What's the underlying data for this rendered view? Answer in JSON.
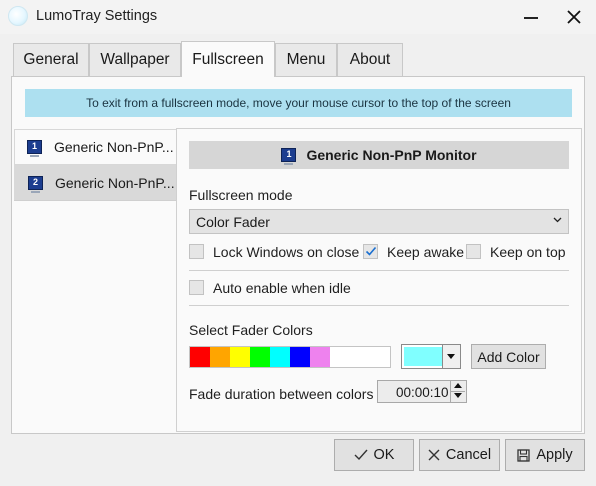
{
  "window": {
    "title": "LumoTray Settings",
    "icons": {
      "app": "app-icon",
      "minimize": "minimize-icon",
      "close": "close-icon"
    }
  },
  "tabs": [
    {
      "label": "General",
      "active": false
    },
    {
      "label": "Wallpaper",
      "active": false
    },
    {
      "label": "Fullscreen",
      "active": true
    },
    {
      "label": "Menu",
      "active": false
    },
    {
      "label": "About",
      "active": false
    }
  ],
  "info_banner": "To exit from a fullscreen mode, move your mouse cursor to the top of the screen",
  "monitors": [
    {
      "number": "1",
      "label": "Generic Non-PnP...",
      "selected": true
    },
    {
      "number": "2",
      "label": "Generic Non-PnP...",
      "selected": false
    }
  ],
  "detail": {
    "monitor_number": "1",
    "monitor_name": "Generic Non-PnP Monitor",
    "fullscreen_mode_label": "Fullscreen mode",
    "fullscreen_mode_value": "Color Fader",
    "checkboxes": {
      "lock_windows": {
        "label": "Lock Windows on close",
        "checked": false
      },
      "keep_awake": {
        "label": "Keep awake",
        "checked": true
      },
      "keep_on_top": {
        "label": "Keep on top",
        "checked": false
      },
      "auto_enable": {
        "label": "Auto enable when idle",
        "checked": false
      }
    },
    "fader_colors_label": "Select Fader Colors",
    "fader_colors": [
      "#ff0000",
      "#ffa500",
      "#ffff00",
      "#00ff00",
      "#00ffff",
      "#0000ff",
      "#ee82ee"
    ],
    "picker_color": "#80ffff",
    "add_color_label": "Add Color",
    "fade_duration_label": "Fade duration between colors",
    "fade_duration_value": "00:00:10"
  },
  "buttons": {
    "ok": "OK",
    "cancel": "Cancel",
    "apply": "Apply"
  }
}
